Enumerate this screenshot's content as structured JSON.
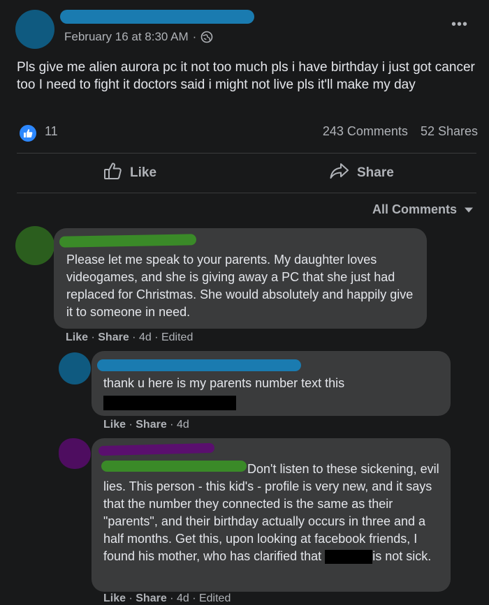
{
  "post": {
    "date": "February 16 at 8:30 AM",
    "separator": "·",
    "privacy_icon": "globe-icon",
    "more_icon": "more-options-icon",
    "more_glyph": "•••",
    "text": "Pls give me alien aurora pc it not too much pls i have birthday i just got cancer too I need to fight it doctors said i might not live pls it'll make my day",
    "reaction_count": "11",
    "comments_count": "243 Comments",
    "shares_count": "52 Shares"
  },
  "actions": {
    "like_label": "Like",
    "share_label": "Share"
  },
  "comments_filter": {
    "label": "All Comments"
  },
  "comments": [
    {
      "text": "Please let me speak to your parents. My daughter loves videogames, and she is giving away a PC that she just had replaced for Christmas. She would absolutely and happily give it to someone in need.",
      "like": "Like",
      "share": "Share",
      "time": "4d",
      "edited": "Edited"
    },
    {
      "text": "thank u here is my parents number text this",
      "like": "Like",
      "share": "Share",
      "time": "4d"
    },
    {
      "text_start": "Don't listen to these sickening, evil lies. This person - this kid's - profile is very new, and it says that the number they connected is the same as their \"parents\", and their birthday actually occurs in three and a half months. Get this, upon looking at facebook friends, I found his mother, who has clarified that",
      "text_end": "is not sick.",
      "like": "Like",
      "share": "Share",
      "time": "4d",
      "edited": "Edited"
    }
  ],
  "colors": {
    "background": "#18191a",
    "bubble": "#3a3b3c",
    "accent": "#2d88ff",
    "scribble_blue": "#1a7bb0",
    "scribble_green": "#3a8a28",
    "scribble_purple": "#5a0f6e"
  }
}
